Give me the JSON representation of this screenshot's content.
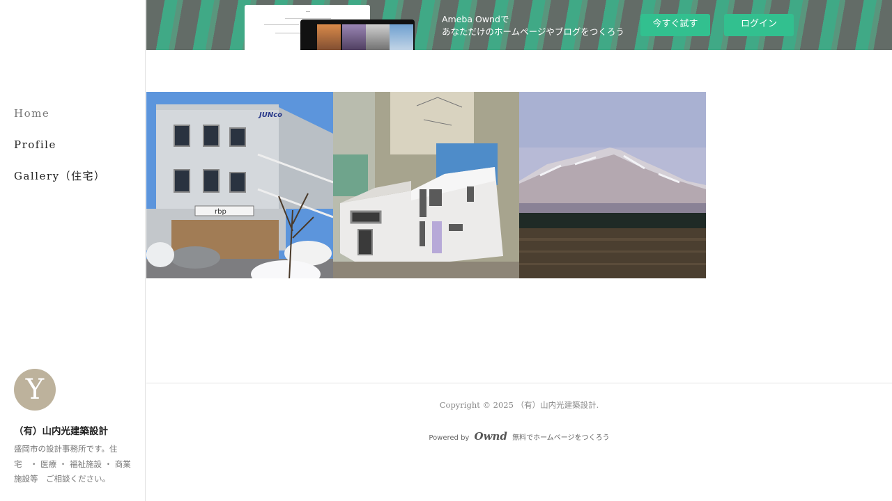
{
  "banner": {
    "line1": "Ameba Owndで",
    "line2": "あなただけのホームページやブログをつくろう",
    "try_button": "今すぐ試す",
    "login_button": "ログイン"
  },
  "nav": {
    "items": [
      {
        "label": "Home",
        "current": true
      },
      {
        "label": "Profile"
      },
      {
        "label": "Gallery（住宅）"
      }
    ]
  },
  "profile": {
    "avatar_letter": "Y",
    "site_name": "（有）山内光建築設計",
    "description": "盛岡市の設計事務所です。住宅　・ 医療 ・ 福祉施設 ・ 商業施設等　ご相談ください。"
  },
  "gallery": {
    "photos": [
      {
        "subject": "office-building-photo",
        "sign_text": "JUNco",
        "store_sign": "rbp"
      },
      {
        "subject": "house-model-photo"
      },
      {
        "subject": "mountain-landscape-photo"
      }
    ]
  },
  "footer": {
    "copyright": "Copyright © 2025 （有）山内光建築設計.",
    "powered_by": "Powered by",
    "logo": "Ownd",
    "tagline": "無料でホームページをつくろう"
  },
  "colors": {
    "accent": "#32c08f",
    "avatar_bg": "#bdb29c"
  }
}
